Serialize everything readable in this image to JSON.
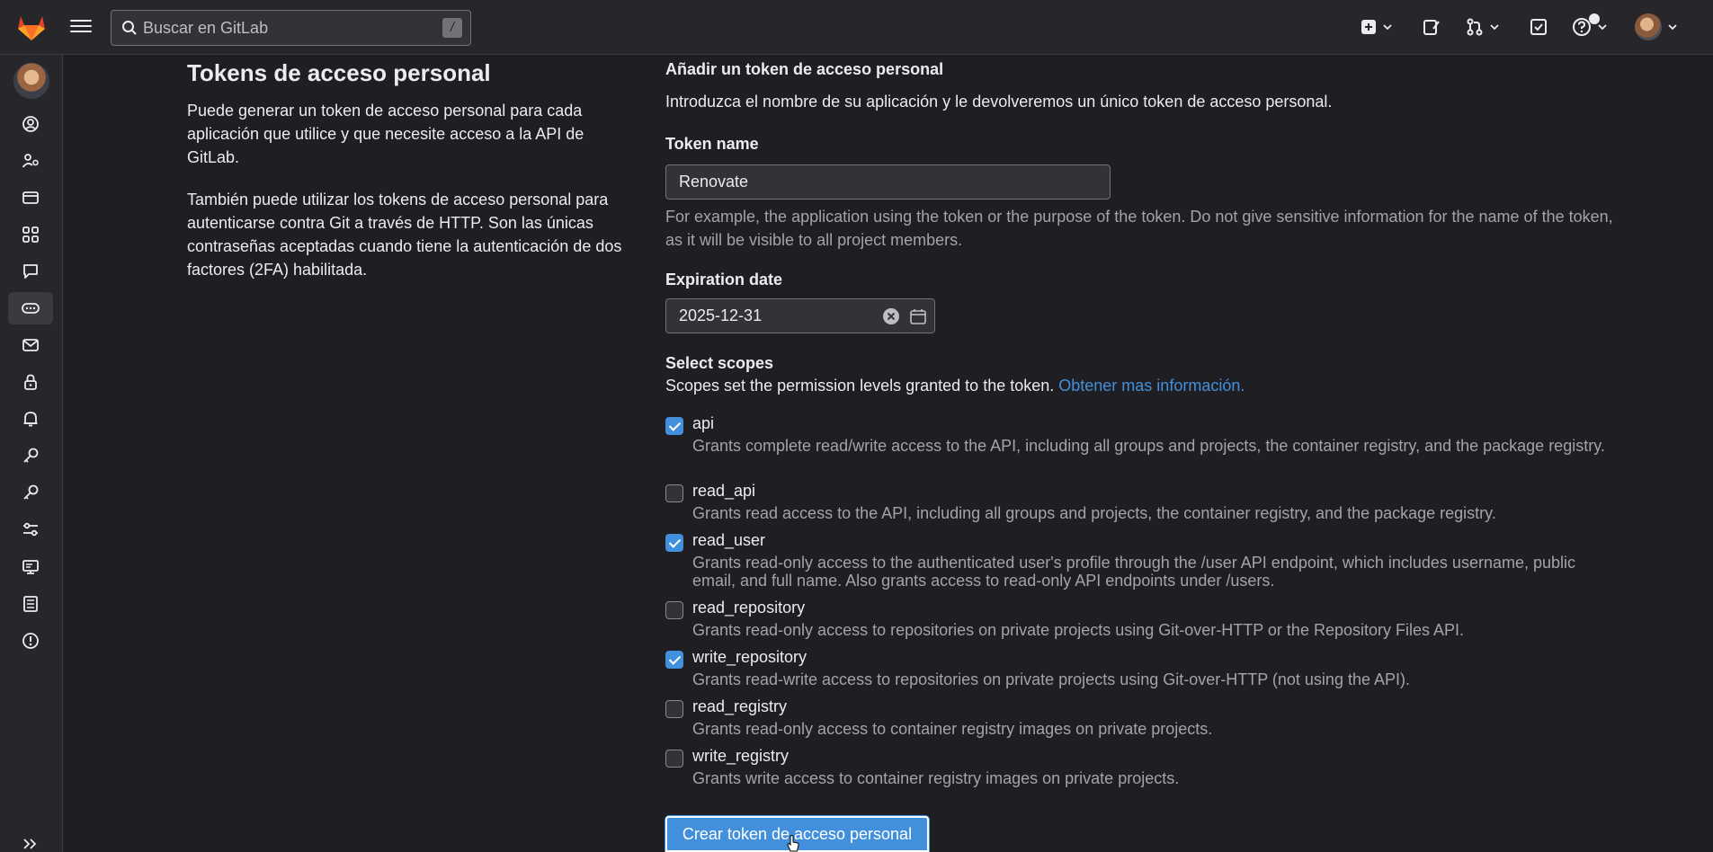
{
  "topbar": {
    "search_placeholder": "Buscar en GitLab",
    "search_shortcut": "/"
  },
  "sidebar": {
    "items": [
      {
        "icon": "profile-icon"
      },
      {
        "icon": "account-icon"
      },
      {
        "icon": "billing-icon"
      },
      {
        "icon": "applications-icon"
      },
      {
        "icon": "chat-icon"
      },
      {
        "icon": "access-tokens-icon",
        "active": true
      },
      {
        "icon": "emails-icon"
      },
      {
        "icon": "password-icon"
      },
      {
        "icon": "notifications-icon"
      },
      {
        "icon": "ssh-keys-icon"
      },
      {
        "icon": "gpg-keys-icon"
      },
      {
        "icon": "preferences-icon"
      },
      {
        "icon": "active-sessions-icon"
      },
      {
        "icon": "authentication-log-icon"
      },
      {
        "icon": "usage-quotas-icon"
      }
    ]
  },
  "intro": {
    "title": "Tokens de acceso personal",
    "paragraph1": "Puede generar un token de acceso personal para cada aplicación que utilice y que necesite acceso a la API de GitLab.",
    "paragraph2": "También puede utilizar los tokens de acceso personal para autenticarse contra Git a través de HTTP. Son las únicas contraseñas aceptadas cuando tiene la autenticación de dos factores (2FA) habilitada."
  },
  "form": {
    "heading": "Añadir un token de acceso personal",
    "intro": "Introduzca el nombre de su aplicación y le devolveremos un único token de acceso personal.",
    "token_name_label": "Token name",
    "token_name_value": "Renovate",
    "token_name_help": "For example, the application using the token or the purpose of the token. Do not give sensitive information for the name of the token, as it will be visible to all project members.",
    "expiration_label": "Expiration date",
    "expiration_value": "2025-12-31",
    "scopes_label": "Select scopes",
    "scopes_help": "Scopes set the permission levels granted to the token.",
    "scopes_link": "Obtener mas información.",
    "scopes": [
      {
        "name": "api",
        "checked": true,
        "desc": "Grants complete read/write access to the API, including all groups and projects, the container registry, and the package registry."
      },
      {
        "name": "read_api",
        "checked": false,
        "desc": "Grants read access to the API, including all groups and projects, the container registry, and the package registry."
      },
      {
        "name": "read_user",
        "checked": true,
        "desc": "Grants read-only access to the authenticated user's profile through the /user API endpoint, which includes username, public email, and full name. Also grants access to read-only API endpoints under /users."
      },
      {
        "name": "read_repository",
        "checked": false,
        "desc": "Grants read-only access to repositories on private projects using Git-over-HTTP or the Repository Files API."
      },
      {
        "name": "write_repository",
        "checked": true,
        "desc": "Grants read-write access to repositories on private projects using Git-over-HTTP (not using the API)."
      },
      {
        "name": "read_registry",
        "checked": false,
        "desc": "Grants read-only access to container registry images on private projects."
      },
      {
        "name": "write_registry",
        "checked": false,
        "desc": "Grants write access to container registry images on private projects."
      }
    ],
    "submit_label": "Crear token de acceso personal"
  }
}
